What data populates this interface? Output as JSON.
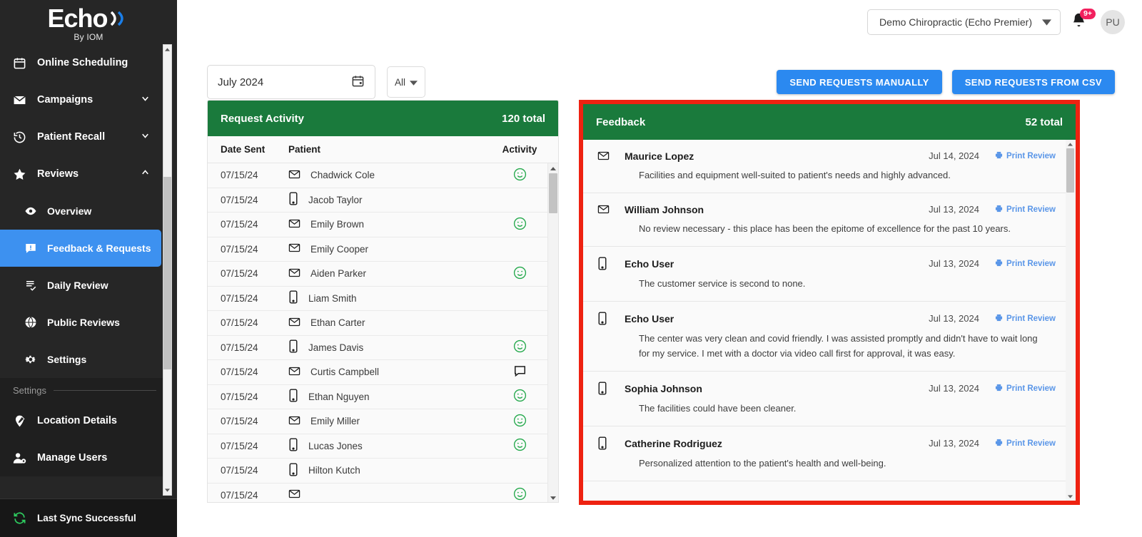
{
  "brand": {
    "logo_text": "Echo",
    "logo_sub": "By IOM",
    "accent_blue": "#3d91f0",
    "accent_green": "#1a7a3c",
    "highlight_red": "#ee2211"
  },
  "sidebar": {
    "items": [
      {
        "label": "Online Scheduling",
        "icon": "calendar-icon",
        "chevron": "",
        "active": false
      },
      {
        "label": "Campaigns",
        "icon": "envelope-icon",
        "chevron": "⌄",
        "active": false
      },
      {
        "label": "Patient Recall",
        "icon": "history-icon",
        "chevron": "⌄",
        "active": false
      },
      {
        "label": "Reviews",
        "icon": "star-icon",
        "chevron": "⌃",
        "active": false
      }
    ],
    "sub_items": [
      {
        "label": "Overview",
        "icon": "eye-icon",
        "active": false
      },
      {
        "label": "Feedback & Requests",
        "icon": "feedback-icon",
        "active": true
      },
      {
        "label": "Daily Review",
        "icon": "list-check-icon",
        "active": false
      },
      {
        "label": "Public Reviews",
        "icon": "globe-icon",
        "active": false
      },
      {
        "label": "Settings",
        "icon": "gear-icon",
        "active": false
      }
    ],
    "section_label": "Settings",
    "settings_items": [
      {
        "label": "Location Details",
        "icon": "location-edit-icon"
      },
      {
        "label": "Manage Users",
        "icon": "user-gear-icon"
      }
    ],
    "sync_status": "Last Sync Successful",
    "sync_icon": "sync-icon"
  },
  "header": {
    "location": "Demo Chiropractic (Echo Premier)",
    "notification_count": "9+",
    "avatar_initials": "PU"
  },
  "toolbar": {
    "date_value": "July 2024",
    "date_icon": "calendar-icon",
    "filter_value": "All",
    "send_manually_label": "SEND REQUESTS MANUALLY",
    "send_csv_label": "SEND REQUESTS FROM CSV"
  },
  "request_activity": {
    "title": "Request Activity",
    "total": "120 total",
    "columns": [
      "Date Sent",
      "Patient",
      "Activity"
    ],
    "rows": [
      {
        "date": "07/15/24",
        "channel": "email-icon",
        "patient": "Chadwick Cole",
        "activity": "smiley-icon"
      },
      {
        "date": "07/15/24",
        "channel": "phone-icon",
        "patient": "Jacob Taylor",
        "activity": ""
      },
      {
        "date": "07/15/24",
        "channel": "email-icon",
        "patient": "Emily Brown",
        "activity": "smiley-icon"
      },
      {
        "date": "07/15/24",
        "channel": "email-icon",
        "patient": "Emily Cooper",
        "activity": ""
      },
      {
        "date": "07/15/24",
        "channel": "email-icon",
        "patient": "Aiden Parker",
        "activity": "smiley-icon"
      },
      {
        "date": "07/15/24",
        "channel": "phone-icon",
        "patient": "Liam Smith",
        "activity": ""
      },
      {
        "date": "07/15/24",
        "channel": "email-icon",
        "patient": "Ethan Carter",
        "activity": ""
      },
      {
        "date": "07/15/24",
        "channel": "phone-icon",
        "patient": "James Davis",
        "activity": "smiley-icon"
      },
      {
        "date": "07/15/24",
        "channel": "email-icon",
        "patient": "Curtis Campbell",
        "activity": "comment-icon"
      },
      {
        "date": "07/15/24",
        "channel": "phone-icon",
        "patient": "Ethan Nguyen",
        "activity": "smiley-icon"
      },
      {
        "date": "07/15/24",
        "channel": "email-icon",
        "patient": "Emily Miller",
        "activity": "smiley-icon"
      },
      {
        "date": "07/15/24",
        "channel": "phone-icon",
        "patient": "Lucas Jones",
        "activity": "smiley-icon"
      },
      {
        "date": "07/15/24",
        "channel": "phone-icon",
        "patient": "Hilton Kutch",
        "activity": ""
      },
      {
        "date": "07/15/24",
        "channel": "email-icon",
        "patient": "",
        "activity": "smiley-icon"
      }
    ]
  },
  "feedback": {
    "title": "Feedback",
    "total": "52 total",
    "print_label": "Print Review",
    "items": [
      {
        "channel": "email-icon",
        "name": "Maurice Lopez",
        "date": "Jul 14, 2024",
        "text": "Facilities and equipment well-suited to patient's needs and highly advanced."
      },
      {
        "channel": "email-icon",
        "name": "William Johnson",
        "date": "Jul 13, 2024",
        "text": "No review necessary - this place has been the epitome of excellence for the past 10 years."
      },
      {
        "channel": "phone-icon",
        "name": "Echo User",
        "date": "Jul 13, 2024",
        "text": "The customer service is second to none."
      },
      {
        "channel": "phone-icon",
        "name": "Echo User",
        "date": "Jul 13, 2024",
        "text": "The center was very clean and covid friendly. I was assisted promptly and didn't have to wait long\nfor my service. I met with a doctor via video call first for approval, it was easy."
      },
      {
        "channel": "phone-icon",
        "name": "Sophia Johnson",
        "date": "Jul 13, 2024",
        "text": "The facilities could have been cleaner."
      },
      {
        "channel": "phone-icon",
        "name": "Catherine Rodriguez",
        "date": "Jul 13, 2024",
        "text": "Personalized attention to the patient's health and well-being."
      }
    ]
  }
}
